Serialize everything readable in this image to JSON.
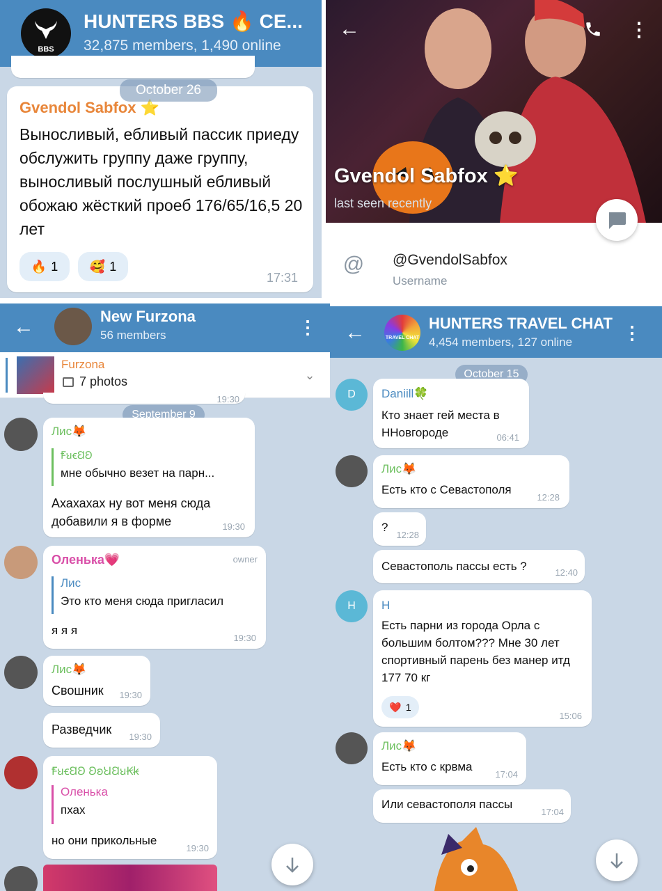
{
  "panel1": {
    "title": "HUNTERS BBS 🔥 CE...",
    "subtitle": "32,875 members, 1,490 online",
    "avatar_text": "BBS",
    "date": "October 26",
    "author": "Gvendol Sabfox ⭐",
    "message": "Выносливый, ебливый пассик приеду обслужить группу даже группу, выносливый послушный ебливый обожаю жёсткий проеб 176/65/16,5  20 лет",
    "reactions": [
      {
        "emoji": "🔥",
        "count": "1"
      },
      {
        "emoji": "🥰",
        "count": "1"
      }
    ],
    "time": "17:31"
  },
  "panel2": {
    "name": "Gvendol Sabfox ⭐",
    "status": "last seen recently",
    "username": "@GvendolSabfox",
    "username_label": "Username"
  },
  "panel3": {
    "title": "New Furzona",
    "subtitle": "56 members",
    "pinned_title": "Furzona",
    "pinned_sub": "7 photos",
    "prev_time": "19:30",
    "date": "September 9",
    "messages": [
      {
        "author": "Лис🦊",
        "reply_author": "ꞘꞟꞓꞚꞜ",
        "reply_text": "мне обычно везет на парн...",
        "text": "Ахахахах ну вот меня сюда добавили я в форме",
        "time": "19:30"
      },
      {
        "author": "Оленька💗",
        "badge": "owner",
        "reply_author": "Лис",
        "reply_text": "Это кто меня сюда пригласил",
        "text": "я я я",
        "time": "19:30"
      },
      {
        "author": "Лис🦊",
        "text": "Свошник",
        "time": "19:30"
      },
      {
        "text": "Разведчик",
        "time": "19:30"
      },
      {
        "author": "ꞘꞟꞓꞚꞜ ꞜꞝꞞꞚꞟꞢꞣ",
        "reply_author": "Оленька",
        "reply_text": "пхах",
        "text": "но они прикольные",
        "time": "19:30"
      }
    ]
  },
  "panel4": {
    "title": "HUNTERS TRAVEL CHAT",
    "subtitle": "4,454 members, 127 online",
    "avatar_text": "TRAVEL CHAT",
    "date": "October 15",
    "messages": [
      {
        "avatar": "D",
        "author": "Daniill🍀",
        "text": "Кто знает гей места в ННовгороде",
        "time": "06:41"
      },
      {
        "author": "Лис🦊",
        "text": "Есть кто с Севастополя",
        "time": "12:28"
      },
      {
        "text": "?",
        "time": "12:28"
      },
      {
        "text": "Севастополь пассы есть ?",
        "time": "12:40"
      },
      {
        "avatar": "H",
        "author": "H",
        "text": "Есть парни из города Орла с большим болтом??? Мне 30 лет спортивный парень без манер итд 177 70 кг",
        "reaction": "❤️",
        "reaction_count": "1",
        "time": "15:06"
      },
      {
        "author": "Лис🦊",
        "text": "Есть кто с крвма",
        "time": "17:04"
      },
      {
        "text": "Или севастополя пассы",
        "time": "17:04"
      }
    ]
  },
  "colors": {
    "header": "#4a8ac0",
    "accent_orange": "#e8863a",
    "accent_green": "#6cbf5e",
    "accent_pink": "#d94fa8",
    "chat_bg": "#c9d7e6"
  }
}
